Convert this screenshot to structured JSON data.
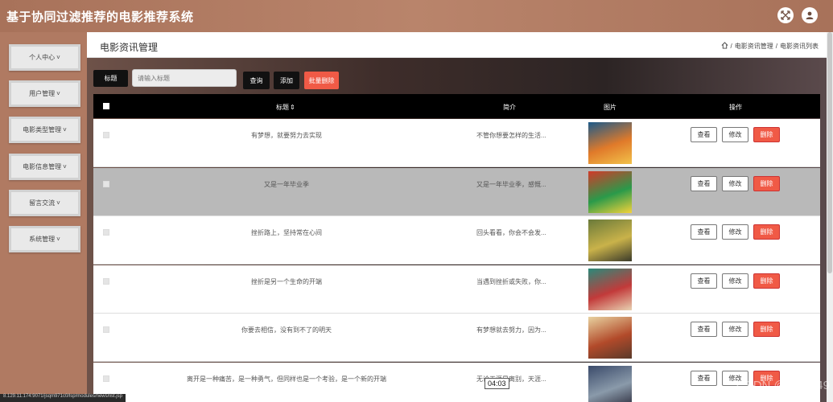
{
  "app_title": "基于协同过滤推荐的电影推荐系统",
  "top_icons": [
    "fullscreen-icon",
    "user-icon"
  ],
  "sidebar": {
    "items": [
      {
        "label": "个人中心",
        "arrow": "˅"
      },
      {
        "label": "用户管理",
        "arrow": "˅"
      },
      {
        "label": "电影类型管理",
        "arrow": "˅"
      },
      {
        "label": "电影信息管理",
        "arrow": "˅"
      },
      {
        "label": "留言交流",
        "arrow": "˅"
      },
      {
        "label": "系统管理",
        "arrow": "˅"
      }
    ]
  },
  "page": {
    "title": "电影资讯管理",
    "breadcrumb": [
      "电影资讯管理",
      "电影资讯列表"
    ],
    "breadcrumb_sep": "/"
  },
  "search": {
    "label": "标题",
    "placeholder": "请输入标题",
    "query_label": "查询",
    "add_label": "添加",
    "bulk_delete_label": "批量删除"
  },
  "table": {
    "columns": [
      "标题",
      "简介",
      "图片",
      "操作"
    ],
    "sort_icon": "sort-icon",
    "actions": {
      "view": "查看",
      "edit": "修改",
      "delete": "删除"
    },
    "rows": [
      {
        "title": "有梦想，就要努力去实现",
        "intro": "不管你想要怎样的生活...",
        "poster_colors": [
          "#1c5a8a",
          "#e07a2a",
          "#f2c24a"
        ]
      },
      {
        "title": "又是一年毕业季",
        "intro": "又是一年毕业季，感慨...",
        "poster_colors": [
          "#d23a2a",
          "#2a9a4a",
          "#f4d23a"
        ]
      },
      {
        "title": "挫折路上，坚持常在心间",
        "intro": "回头看看，你会不会发...",
        "poster_colors": [
          "#6a7a3a",
          "#c9b24a",
          "#3a3a2a"
        ]
      },
      {
        "title": "挫折是另一个生命的开端",
        "intro": "当遇到挫折或失败，你...",
        "poster_colors": [
          "#2a8a7a",
          "#c23a3a",
          "#e8d2b2"
        ]
      },
      {
        "title": "你要去相信，没有到不了的明天",
        "intro": "有梦想就去努力，因为...",
        "poster_colors": [
          "#e8d2a0",
          "#b24a2a",
          "#5a3a2a"
        ]
      },
      {
        "title": "离开是一种痛苦，是一种勇气，但同样也是一个考验，是一个新的开端",
        "intro": "无论天涯是离别，天涯...",
        "poster_colors": [
          "#3a4a6a",
          "#8a9aaa",
          "#2a2a3a"
        ]
      }
    ],
    "highlighted_row": 1
  },
  "status_url": "8.129.11.174:9071/jsqm971c0/lsp/modules/news/list.jsp",
  "video_timestamp": "04:03",
  "watermark": "CSDN @CK3049"
}
